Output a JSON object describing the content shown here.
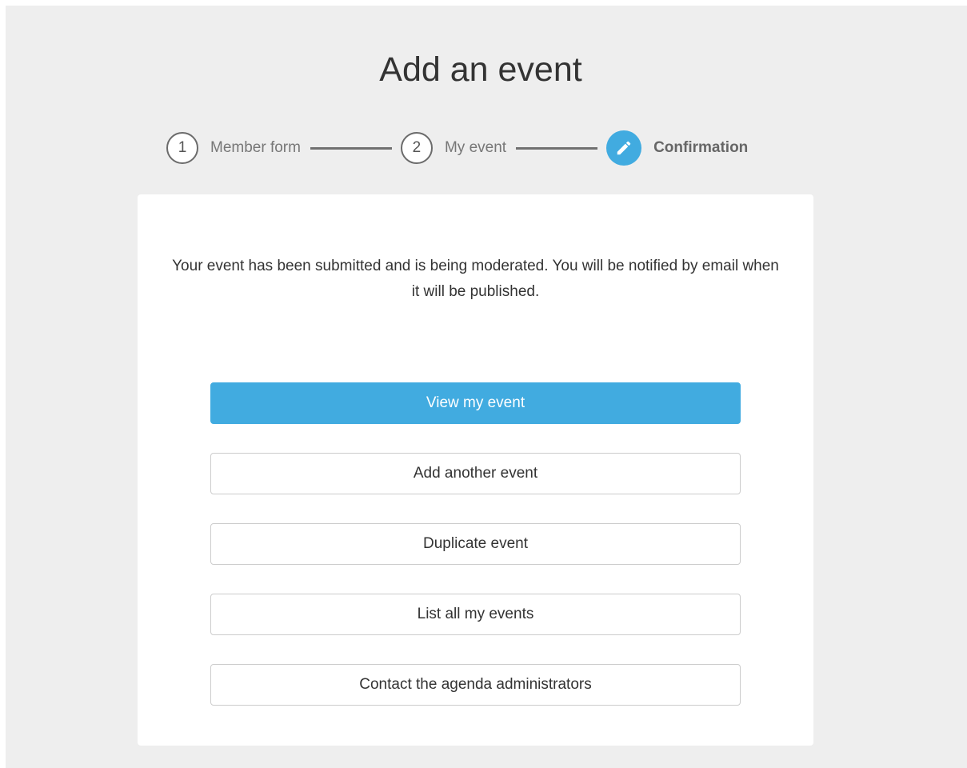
{
  "page": {
    "title": "Add an event"
  },
  "steps": [
    {
      "number": "1",
      "label": "Member form",
      "state": "done"
    },
    {
      "number": "2",
      "label": "My event",
      "state": "done"
    },
    {
      "number": "",
      "label": "Confirmation",
      "state": "active",
      "icon": "pencil-icon"
    }
  ],
  "confirmation": {
    "message": "Your event has been submitted and is being moderated. You will be notified by email when it will be published."
  },
  "actions": {
    "view_event": "View my event",
    "add_another": "Add another event",
    "duplicate": "Duplicate event",
    "list_events": "List all my events",
    "contact_admins": "Contact the agenda administrators"
  },
  "colors": {
    "accent": "#41abe0",
    "background": "#eeeeee",
    "card": "#ffffff",
    "text": "#333333"
  }
}
